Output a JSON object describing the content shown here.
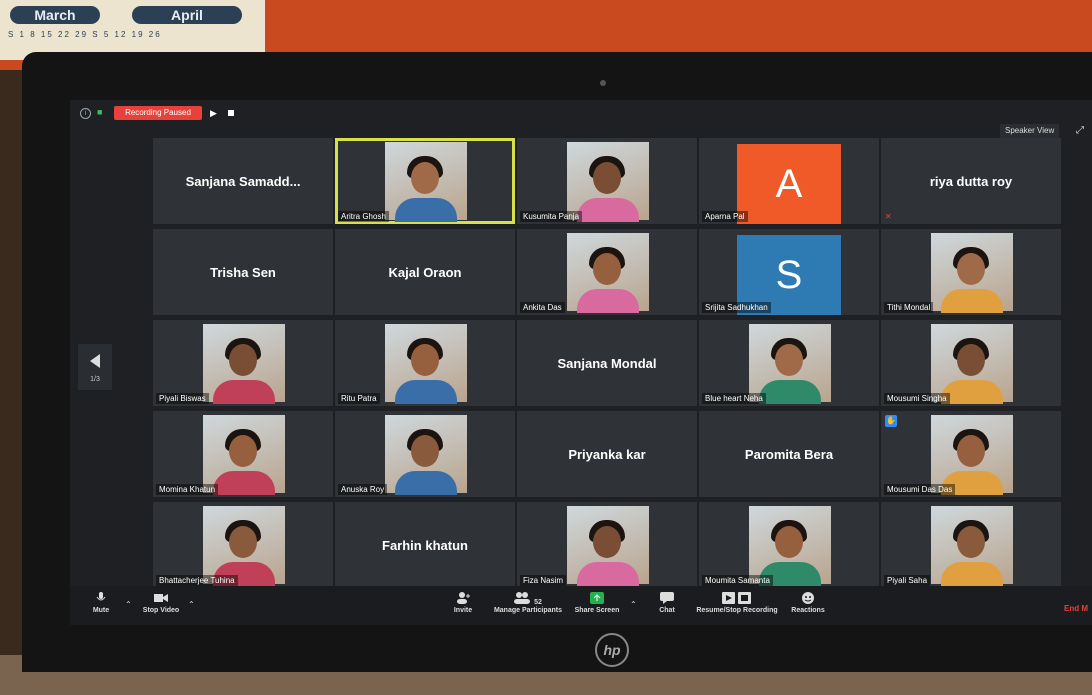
{
  "background": {
    "calendar": {
      "month1": "March",
      "month2": "April",
      "row": "S 1 8 15 22 29   S 5 12 19 26"
    }
  },
  "topbar": {
    "recording_label": "Recording Paused",
    "speaker_view_label": "Speaker View"
  },
  "pager": {
    "count": "1/3"
  },
  "tiles": [
    {
      "name": "Sanjana Samadd...",
      "type": "name"
    },
    {
      "name": "Aritra Ghosh",
      "type": "video",
      "active": true
    },
    {
      "name": "Kusumita Panja",
      "type": "video"
    },
    {
      "name": "Aparna Pal",
      "type": "avatar",
      "letter": "A",
      "color": "#f05a28"
    },
    {
      "name": "riya dutta roy",
      "type": "name",
      "muted": true
    },
    {
      "name": "Trisha Sen",
      "type": "name"
    },
    {
      "name": "Kajal Oraon",
      "type": "name"
    },
    {
      "name": "Ankita Das",
      "type": "video"
    },
    {
      "name": "Srijita Sadhukhan",
      "type": "avatar",
      "letter": "S",
      "color": "#2e7bb4"
    },
    {
      "name": "Tithi Mondal",
      "type": "video"
    },
    {
      "name": "Piyali Biswas",
      "type": "video"
    },
    {
      "name": "Ritu Patra",
      "type": "video"
    },
    {
      "name": "Sanjana Mondal",
      "type": "name"
    },
    {
      "name": "Blue heart Neha",
      "type": "video"
    },
    {
      "name": "Mousumi Singha",
      "type": "video"
    },
    {
      "name": "Momina Khatun",
      "type": "video"
    },
    {
      "name": "Anuska Roy",
      "type": "video"
    },
    {
      "name": "Priyanka kar",
      "type": "name"
    },
    {
      "name": "Paromita Bera",
      "type": "name"
    },
    {
      "name": "Mousumi Das Das",
      "type": "video",
      "raised": true
    },
    {
      "name": "Bhattacherjee Tuhina",
      "type": "video"
    },
    {
      "name": "Farhin khatun",
      "type": "name"
    },
    {
      "name": "Fiza Nasim",
      "type": "video"
    },
    {
      "name": "Moumita Samanta",
      "type": "video"
    },
    {
      "name": "Piyali Saha",
      "type": "video"
    }
  ],
  "toolbar": {
    "mute_label": "Mute",
    "stop_video_label": "Stop Video",
    "invite_label": "Invite",
    "manage_participants_label": "Manage Participants",
    "participants_count": "52",
    "share_screen_label": "Share Screen",
    "chat_label": "Chat",
    "recording_label": "Resume/Stop Recording",
    "reactions_label": "Reactions",
    "end_label": "End M"
  },
  "device": {
    "brand": "hp"
  }
}
